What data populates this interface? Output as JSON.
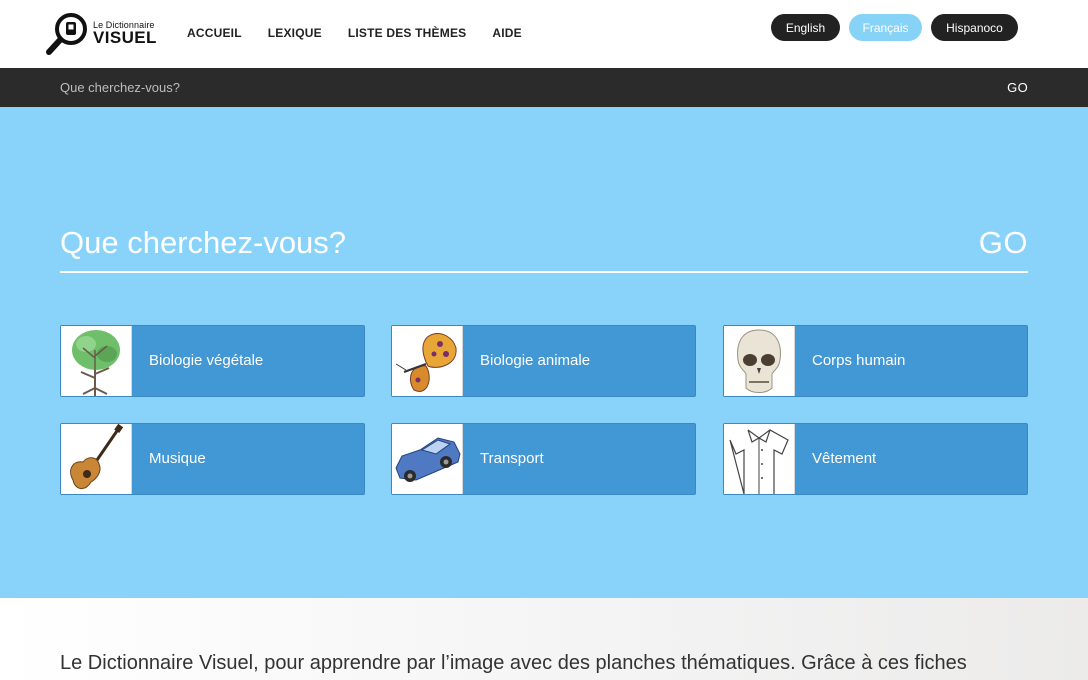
{
  "header": {
    "logo_small": "Le Dictionnaire",
    "logo_big": "VISUEL",
    "nav": [
      "ACCUEIL",
      "LEXIQUE",
      "LISTE DES THÈMES",
      "AIDE"
    ],
    "languages": [
      {
        "label": "English",
        "active": false
      },
      {
        "label": "Français",
        "active": true
      },
      {
        "label": "Hispanoco",
        "active": false
      }
    ]
  },
  "search_strip": {
    "placeholder": "Que cherchez-vous?",
    "go": "GO"
  },
  "hero": {
    "placeholder": "Que cherchez-vous?",
    "go": "GO"
  },
  "themes": [
    {
      "label": "Biologie végétale",
      "icon": "tree-icon"
    },
    {
      "label": "Biologie animale",
      "icon": "butterfly-icon"
    },
    {
      "label": "Corps humain",
      "icon": "skull-icon"
    },
    {
      "label": "Musique",
      "icon": "guitar-icon"
    },
    {
      "label": "Transport",
      "icon": "car-icon"
    },
    {
      "label": "Vêtement",
      "icon": "shirt-icon"
    }
  ],
  "intro": {
    "text": "Le Dictionnaire Visuel, pour apprendre par l’image avec des planches thématiques. Grâce à ces fiches"
  },
  "colors": {
    "hero_bg": "#89d3fb",
    "card_bg": "#4297d5",
    "dark_strip": "#2b2b2b",
    "active_lang": "#87d3f8"
  }
}
